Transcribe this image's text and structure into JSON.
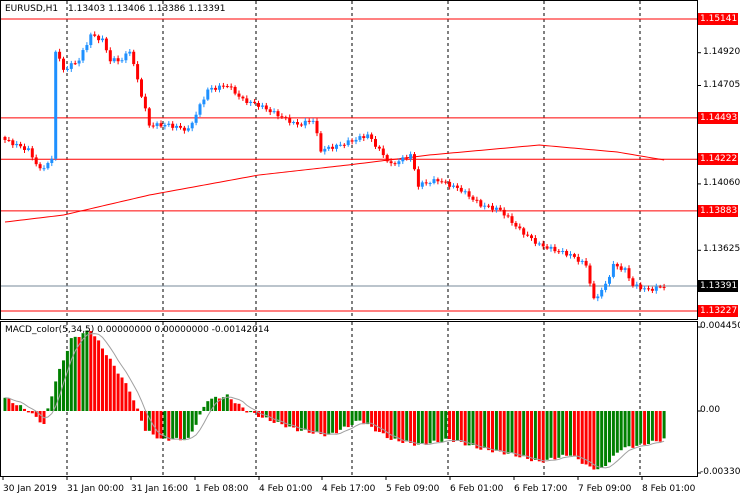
{
  "header": {
    "symbol": "EURUSD,H1",
    "ohlc": "1.13403 1.13406 1.13386 1.13391"
  },
  "macd_header": {
    "title": "MACD_color(5,34,5) 0.00000000 0.00000000 -0.00142014"
  },
  "colors": {
    "bull": "#1e90ff",
    "bear": "#ff0000",
    "level": "#ff0000",
    "macd_up": "#008000",
    "macd_down": "#ff0000",
    "current": "#000000"
  },
  "chart_data": [
    {
      "type": "candlestick",
      "title": "EURUSD,H1",
      "ylim": [
        1.1315,
        1.154
      ],
      "y_ticks": [
        "1.14920",
        "1.14705",
        "1.14060",
        "1.13625"
      ],
      "y_tick_values": [
        1.1492,
        1.14705,
        1.1406,
        1.13625
      ],
      "level_lines": [
        {
          "label": "1.15141",
          "value": 1.15141
        },
        {
          "label": "1.14493",
          "value": 1.14493
        },
        {
          "label": "1.14222",
          "value": 1.14222
        },
        {
          "label": "1.13883",
          "value": 1.13883
        },
        {
          "label": "1.13227",
          "value": 1.13227
        }
      ],
      "current_price": {
        "label": "1.13391",
        "value": 1.13391
      },
      "close_keypoints": [
        [
          0,
          1.14348
        ],
        [
          6,
          1.14282
        ],
        [
          9,
          1.14151
        ],
        [
          12,
          1.14217
        ],
        [
          13,
          1.14938
        ],
        [
          15,
          1.14807
        ],
        [
          19,
          1.14872
        ],
        [
          22,
          1.15036
        ],
        [
          25,
          1.15003
        ],
        [
          27,
          1.14872
        ],
        [
          30,
          1.14872
        ],
        [
          32,
          1.14938
        ],
        [
          35,
          1.14643
        ],
        [
          37,
          1.14446
        ],
        [
          42,
          1.14446
        ],
        [
          47,
          1.14413
        ],
        [
          52,
          1.14676
        ],
        [
          57,
          1.14708
        ],
        [
          61,
          1.1461
        ],
        [
          65,
          1.14577
        ],
        [
          70,
          1.14512
        ],
        [
          75,
          1.14446
        ],
        [
          79,
          1.14479
        ],
        [
          81,
          1.14282
        ],
        [
          86,
          1.14315
        ],
        [
          93,
          1.14381
        ],
        [
          99,
          1.14184
        ],
        [
          104,
          1.1425
        ],
        [
          106,
          1.14053
        ],
        [
          111,
          1.14086
        ],
        [
          117,
          1.1402
        ],
        [
          122,
          1.13922
        ],
        [
          127,
          1.13889
        ],
        [
          132,
          1.13758
        ],
        [
          137,
          1.1366
        ],
        [
          145,
          1.13594
        ],
        [
          149,
          1.13528
        ],
        [
          151,
          1.13299
        ],
        [
          154,
          1.13397
        ],
        [
          156,
          1.13528
        ],
        [
          159,
          1.13496
        ],
        [
          161,
          1.13397
        ],
        [
          165,
          1.13365
        ],
        [
          169,
          1.13391
        ]
      ],
      "moving_average_keypoints": [
        [
          0,
          1.1381
        ],
        [
          15,
          1.13856
        ],
        [
          37,
          1.13987
        ],
        [
          65,
          1.14118
        ],
        [
          88,
          1.14184
        ],
        [
          109,
          1.1425
        ],
        [
          137,
          1.14315
        ],
        [
          157,
          1.14269
        ],
        [
          169,
          1.14217
        ]
      ],
      "x_ticks": [
        "30 Jan 2019",
        "31 Jan 00:00",
        "31 Jan 16:00",
        "1 Feb 08:00",
        "4 Feb 01:00",
        "4 Feb 17:00",
        "5 Feb 09:00",
        "6 Feb 01:00",
        "6 Feb 17:00",
        "7 Feb 09:00",
        "8 Feb 01:00"
      ]
    },
    {
      "type": "bar",
      "title": "MACD_color(5,34,5)",
      "ylim": [
        -0.003306,
        0.0044501
      ],
      "y_ticks": [
        "0.0044501",
        "0.00",
        "-0.003306"
      ],
      "hist_keypoints": [
        [
          0,
          0.0007
        ],
        [
          6,
          0.0
        ],
        [
          10,
          -0.0007
        ],
        [
          13,
          0.0016
        ],
        [
          17,
          0.0038
        ],
        [
          22,
          0.0043
        ],
        [
          27,
          0.0027
        ],
        [
          32,
          0.0011
        ],
        [
          36,
          -0.001
        ],
        [
          40,
          -0.0015
        ],
        [
          47,
          -0.0015
        ],
        [
          52,
          0.0006
        ],
        [
          57,
          0.0008
        ],
        [
          62,
          0.0
        ],
        [
          68,
          -0.0005
        ],
        [
          75,
          -0.001
        ],
        [
          83,
          -0.0013
        ],
        [
          91,
          -0.0005
        ],
        [
          99,
          -0.0015
        ],
        [
          106,
          -0.0018
        ],
        [
          114,
          -0.0015
        ],
        [
          122,
          -0.002
        ],
        [
          130,
          -0.0023
        ],
        [
          137,
          -0.0027
        ],
        [
          145,
          -0.0023
        ],
        [
          150,
          -0.003
        ],
        [
          153,
          -0.0031
        ],
        [
          158,
          -0.002
        ],
        [
          163,
          -0.0018
        ],
        [
          169,
          -0.0015
        ]
      ]
    }
  ]
}
